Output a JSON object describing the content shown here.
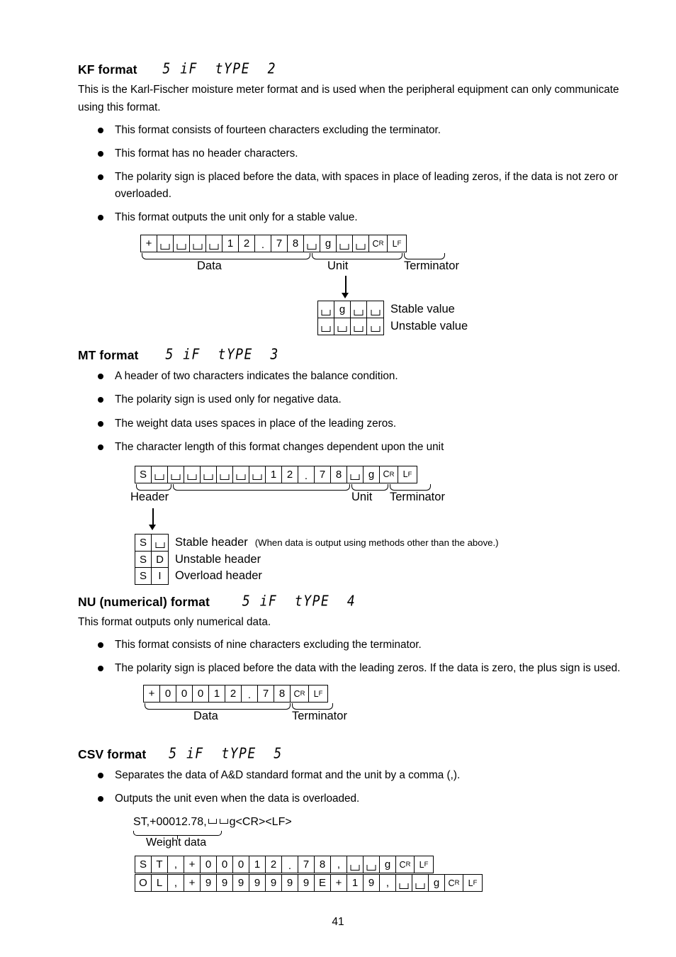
{
  "page": {
    "number": "41"
  },
  "sections": {
    "kf": {
      "title": "KF format",
      "lcd": "5 iF  tYPE  2",
      "intro": "This is the Karl-Fischer moisture meter format and is used when the peripheral equipment can only communicate using this format.",
      "bullets": [
        "This format consists of fourteen characters excluding the terminator.",
        "This format has no header characters.",
        "The polarity sign is placed before the data, with spaces in place of leading zeros, if the data is not zero or overloaded.",
        "This format outputs the unit only for a stable value."
      ],
      "strip": [
        "+",
        "SP",
        "SP",
        "SP",
        "SP",
        "1",
        "2",
        ".",
        "7",
        "8",
        "SP",
        "g",
        "SP",
        "SP",
        "CR",
        "LF"
      ],
      "labels": {
        "data": "Data",
        "unit": "Unit",
        "terminator": "Terminator"
      },
      "unit_detail": {
        "stable_cells": [
          "SP",
          "g",
          "SP",
          "SP"
        ],
        "stable_label": "Stable value",
        "unstable_cells": [
          "SP",
          "SP",
          "SP",
          "SP"
        ],
        "unstable_label": "Unstable value"
      }
    },
    "mt": {
      "title": "MT format",
      "lcd": "5 iF  tYPE  3",
      "bullets": [
        "A header of two characters indicates the balance condition.",
        "The polarity sign is used only for negative data.",
        "The weight data uses spaces in place of the leading zeros.",
        "The character length of this format changes dependent upon the unit"
      ],
      "strip": [
        "S",
        "SP",
        "SP",
        "SP",
        "SP",
        "SP",
        "SP",
        "SP",
        "1",
        "2",
        ".",
        "7",
        "8",
        "SP",
        "g",
        "CR",
        "LF"
      ],
      "labels": {
        "header": "Header",
        "unit": "Unit",
        "terminator": "Terminator"
      },
      "header_types": [
        {
          "cells": [
            "S",
            "SP"
          ],
          "label": "Stable header",
          "note": "(When data is output using methods other than the above.)"
        },
        {
          "cells": [
            "S",
            "D"
          ],
          "label": "Unstable header",
          "note": ""
        },
        {
          "cells": [
            "S",
            "I"
          ],
          "label": "Overload header",
          "note": ""
        }
      ]
    },
    "nu": {
      "title": "NU (numerical) format",
      "lcd": "5 iF  tYPE  4",
      "intro": "This format outputs only numerical data.",
      "bullets": [
        "This format consists of nine characters excluding the terminator.",
        "The polarity sign is placed before the data with the leading zeros. If the data is zero, the plus sign is used."
      ],
      "strip": [
        "+",
        "0",
        "0",
        "0",
        "1",
        "2",
        ".",
        "7",
        "8",
        "CR",
        "LF"
      ],
      "labels": {
        "data": "Data",
        "terminator": "Terminator"
      }
    },
    "csv": {
      "title": "CSV format",
      "lcd": "5 iF  tYPE  5",
      "bullets": [
        "Separates the data of A&D standard format and the unit by a comma (,).",
        "Outputs the unit even when the data is overloaded."
      ],
      "example": {
        "prefix": "ST,+00012.78,",
        "suffix": "g<CR><LF>",
        "brace_label": "Weight data"
      },
      "rows": [
        [
          "S",
          "T",
          ",",
          "+",
          "0",
          "0",
          "0",
          "1",
          "2",
          ".",
          "7",
          "8",
          ",",
          "SP",
          "SP",
          "g",
          "CR",
          "LF"
        ],
        [
          "O",
          "L",
          ",",
          "+",
          "9",
          "9",
          "9",
          "9",
          "9",
          "9",
          "9",
          "E",
          "+",
          "1",
          "9",
          ",",
          "SP",
          "SP",
          "g",
          "CR",
          "LF"
        ]
      ]
    }
  }
}
